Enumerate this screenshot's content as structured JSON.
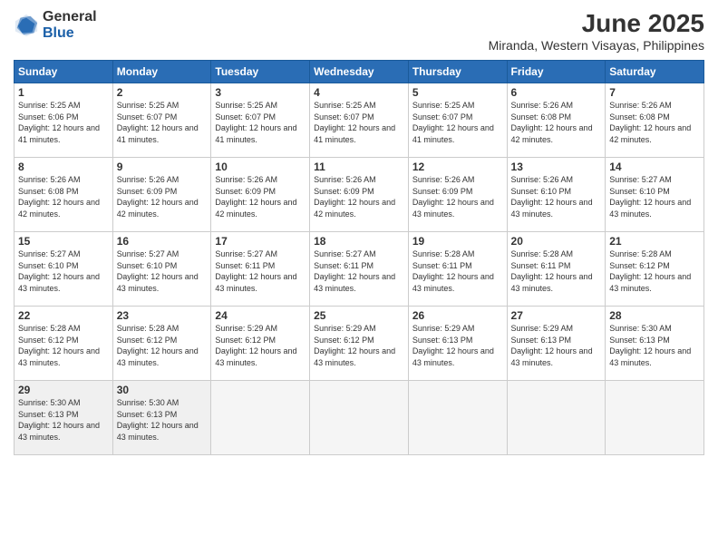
{
  "logo": {
    "general": "General",
    "blue": "Blue"
  },
  "title": "June 2025",
  "location": "Miranda, Western Visayas, Philippines",
  "weekdays": [
    "Sunday",
    "Monday",
    "Tuesday",
    "Wednesday",
    "Thursday",
    "Friday",
    "Saturday"
  ],
  "weeks": [
    [
      {
        "day": 1,
        "sunrise": "5:25 AM",
        "sunset": "6:06 PM",
        "daylight": "12 hours and 41 minutes."
      },
      {
        "day": 2,
        "sunrise": "5:25 AM",
        "sunset": "6:07 PM",
        "daylight": "12 hours and 41 minutes."
      },
      {
        "day": 3,
        "sunrise": "5:25 AM",
        "sunset": "6:07 PM",
        "daylight": "12 hours and 41 minutes."
      },
      {
        "day": 4,
        "sunrise": "5:25 AM",
        "sunset": "6:07 PM",
        "daylight": "12 hours and 41 minutes."
      },
      {
        "day": 5,
        "sunrise": "5:25 AM",
        "sunset": "6:07 PM",
        "daylight": "12 hours and 41 minutes."
      },
      {
        "day": 6,
        "sunrise": "5:26 AM",
        "sunset": "6:08 PM",
        "daylight": "12 hours and 42 minutes."
      },
      {
        "day": 7,
        "sunrise": "5:26 AM",
        "sunset": "6:08 PM",
        "daylight": "12 hours and 42 minutes."
      }
    ],
    [
      {
        "day": 8,
        "sunrise": "5:26 AM",
        "sunset": "6:08 PM",
        "daylight": "12 hours and 42 minutes."
      },
      {
        "day": 9,
        "sunrise": "5:26 AM",
        "sunset": "6:09 PM",
        "daylight": "12 hours and 42 minutes."
      },
      {
        "day": 10,
        "sunrise": "5:26 AM",
        "sunset": "6:09 PM",
        "daylight": "12 hours and 42 minutes."
      },
      {
        "day": 11,
        "sunrise": "5:26 AM",
        "sunset": "6:09 PM",
        "daylight": "12 hours and 42 minutes."
      },
      {
        "day": 12,
        "sunrise": "5:26 AM",
        "sunset": "6:09 PM",
        "daylight": "12 hours and 43 minutes."
      },
      {
        "day": 13,
        "sunrise": "5:26 AM",
        "sunset": "6:10 PM",
        "daylight": "12 hours and 43 minutes."
      },
      {
        "day": 14,
        "sunrise": "5:27 AM",
        "sunset": "6:10 PM",
        "daylight": "12 hours and 43 minutes."
      }
    ],
    [
      {
        "day": 15,
        "sunrise": "5:27 AM",
        "sunset": "6:10 PM",
        "daylight": "12 hours and 43 minutes."
      },
      {
        "day": 16,
        "sunrise": "5:27 AM",
        "sunset": "6:10 PM",
        "daylight": "12 hours and 43 minutes."
      },
      {
        "day": 17,
        "sunrise": "5:27 AM",
        "sunset": "6:11 PM",
        "daylight": "12 hours and 43 minutes."
      },
      {
        "day": 18,
        "sunrise": "5:27 AM",
        "sunset": "6:11 PM",
        "daylight": "12 hours and 43 minutes."
      },
      {
        "day": 19,
        "sunrise": "5:28 AM",
        "sunset": "6:11 PM",
        "daylight": "12 hours and 43 minutes."
      },
      {
        "day": 20,
        "sunrise": "5:28 AM",
        "sunset": "6:11 PM",
        "daylight": "12 hours and 43 minutes."
      },
      {
        "day": 21,
        "sunrise": "5:28 AM",
        "sunset": "6:12 PM",
        "daylight": "12 hours and 43 minutes."
      }
    ],
    [
      {
        "day": 22,
        "sunrise": "5:28 AM",
        "sunset": "6:12 PM",
        "daylight": "12 hours and 43 minutes."
      },
      {
        "day": 23,
        "sunrise": "5:28 AM",
        "sunset": "6:12 PM",
        "daylight": "12 hours and 43 minutes."
      },
      {
        "day": 24,
        "sunrise": "5:29 AM",
        "sunset": "6:12 PM",
        "daylight": "12 hours and 43 minutes."
      },
      {
        "day": 25,
        "sunrise": "5:29 AM",
        "sunset": "6:12 PM",
        "daylight": "12 hours and 43 minutes."
      },
      {
        "day": 26,
        "sunrise": "5:29 AM",
        "sunset": "6:13 PM",
        "daylight": "12 hours and 43 minutes."
      },
      {
        "day": 27,
        "sunrise": "5:29 AM",
        "sunset": "6:13 PM",
        "daylight": "12 hours and 43 minutes."
      },
      {
        "day": 28,
        "sunrise": "5:30 AM",
        "sunset": "6:13 PM",
        "daylight": "12 hours and 43 minutes."
      }
    ],
    [
      {
        "day": 29,
        "sunrise": "5:30 AM",
        "sunset": "6:13 PM",
        "daylight": "12 hours and 43 minutes."
      },
      {
        "day": 30,
        "sunrise": "5:30 AM",
        "sunset": "6:13 PM",
        "daylight": "12 hours and 43 minutes."
      },
      null,
      null,
      null,
      null,
      null
    ]
  ]
}
